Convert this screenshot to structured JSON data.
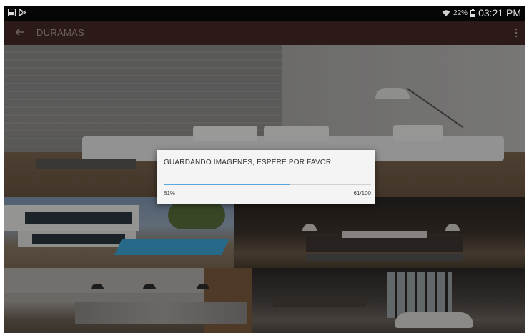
{
  "status_bar": {
    "notification_icons": [
      "gallery-icon",
      "play-store-icon"
    ],
    "wifi_icon": "wifi-icon",
    "battery_percent": "22%",
    "battery_icon": "battery-icon",
    "time": "03:21 PM"
  },
  "toolbar": {
    "title": "DURAMAS",
    "back_icon": "arrow-left-icon",
    "menu_icon": "more-vert-icon"
  },
  "dialog": {
    "message": "GUARDANDO IMAGENES, ESPERE POR FAVOR.",
    "progress_fraction": 0.61,
    "percent_text": "61%",
    "count_text": "61/100"
  },
  "colors": {
    "toolbar_bg": "#2b1a18",
    "progress_fill": "#5aa7dc",
    "progress_track": "#cfcfcf",
    "status_bar_bg": "#050505"
  }
}
